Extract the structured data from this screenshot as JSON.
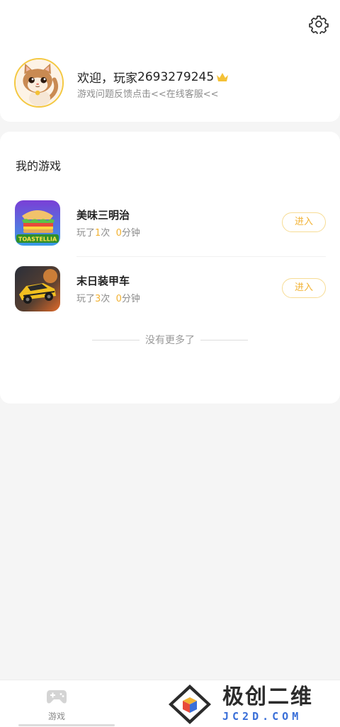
{
  "header": {
    "settings_icon": "gear-icon",
    "welcome_prefix": "欢迎，玩家",
    "player_id": "2693279245",
    "crown_icon": "crown-icon",
    "feedback_text": "游戏问题反馈点击<<在线客服<<",
    "crown_color": "#f4c136"
  },
  "my_games": {
    "title": "我的游戏",
    "games": [
      {
        "name": "美味三明治",
        "icon_text": "TOASTELLIA",
        "stats_prefix": "玩了",
        "play_count": "1",
        "count_unit": "次",
        "play_minutes": "0",
        "minutes_unit": "分钟",
        "enter_label": "进入"
      },
      {
        "name": "末日装甲车",
        "stats_prefix": "玩了",
        "play_count": "3",
        "count_unit": "次",
        "play_minutes": "0",
        "minutes_unit": "分钟",
        "enter_label": "进入"
      }
    ],
    "no_more": "没有更多了"
  },
  "tabbar": {
    "game_tab_label": "游戏",
    "game_tab_icon": "gamepad-icon"
  },
  "watermark": {
    "cn": "极创二维",
    "en": "JC2D.COM"
  },
  "colors": {
    "accent": "#f2b233",
    "accent_border": "#f7dc94",
    "muted_text": "#8c8c8c"
  }
}
